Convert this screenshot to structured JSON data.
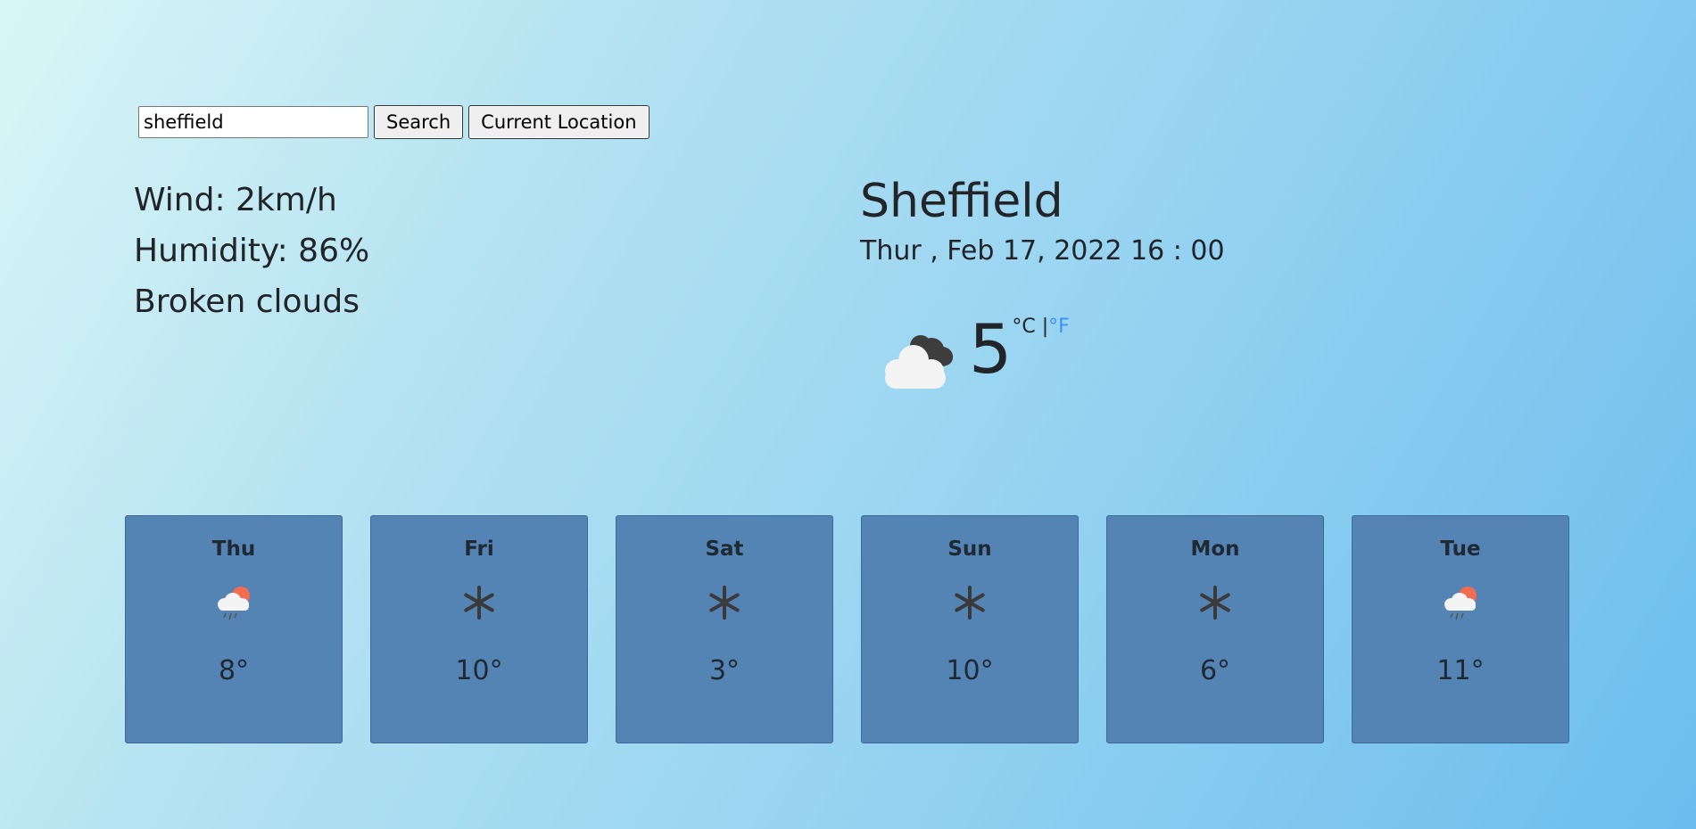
{
  "search": {
    "value": "sheffield",
    "search_label": "Search",
    "location_label": "Current Location"
  },
  "details": {
    "wind": "Wind: 2km/h",
    "humidity": "Humidity: 86%",
    "description": "Broken clouds"
  },
  "current": {
    "city": "Sheffield",
    "date": "Thur , Feb 17, 2022 16 : 00",
    "temperature": "5",
    "unit_c": "°C",
    "separator": "|",
    "unit_f": "°F",
    "icon": "broken-clouds-icon"
  },
  "forecast": [
    {
      "day": "Thu",
      "temp": "8°",
      "icon": "rain-sun-icon"
    },
    {
      "day": "Fri",
      "temp": "10°",
      "icon": "snowflake-icon"
    },
    {
      "day": "Sat",
      "temp": "3°",
      "icon": "snowflake-icon"
    },
    {
      "day": "Sun",
      "temp": "10°",
      "icon": "snowflake-icon"
    },
    {
      "day": "Mon",
      "temp": "6°",
      "icon": "snowflake-icon"
    },
    {
      "day": "Tue",
      "temp": "11°",
      "icon": "rain-sun-icon"
    }
  ],
  "colors": {
    "card_bg": "#5484b4",
    "unit_link": "#3b8ff5"
  }
}
